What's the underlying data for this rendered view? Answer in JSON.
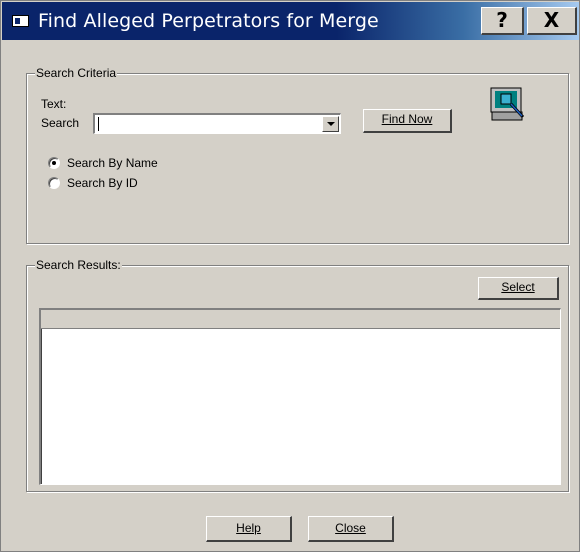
{
  "window": {
    "title": "Find Alleged Perpetrators for Merge",
    "help_glyph": "?",
    "close_glyph": "X"
  },
  "search_criteria": {
    "group_label": "Search Criteria",
    "text_label_line1": "Text:",
    "text_label_line2": "Search",
    "search_value": "",
    "find_button": "Find Now",
    "radio_options": [
      {
        "label": "Search By Name",
        "checked": true
      },
      {
        "label": "Search By ID",
        "checked": false
      }
    ],
    "icon": "computer-search-icon"
  },
  "search_results": {
    "group_label": "Search Results:",
    "select_button": "Select",
    "rows": []
  },
  "footer": {
    "help_button": "Help",
    "close_button": "Close"
  },
  "colors": {
    "face": "#d4d0c8",
    "title_dark": "#0a246a",
    "title_light": "#a6caf0"
  }
}
